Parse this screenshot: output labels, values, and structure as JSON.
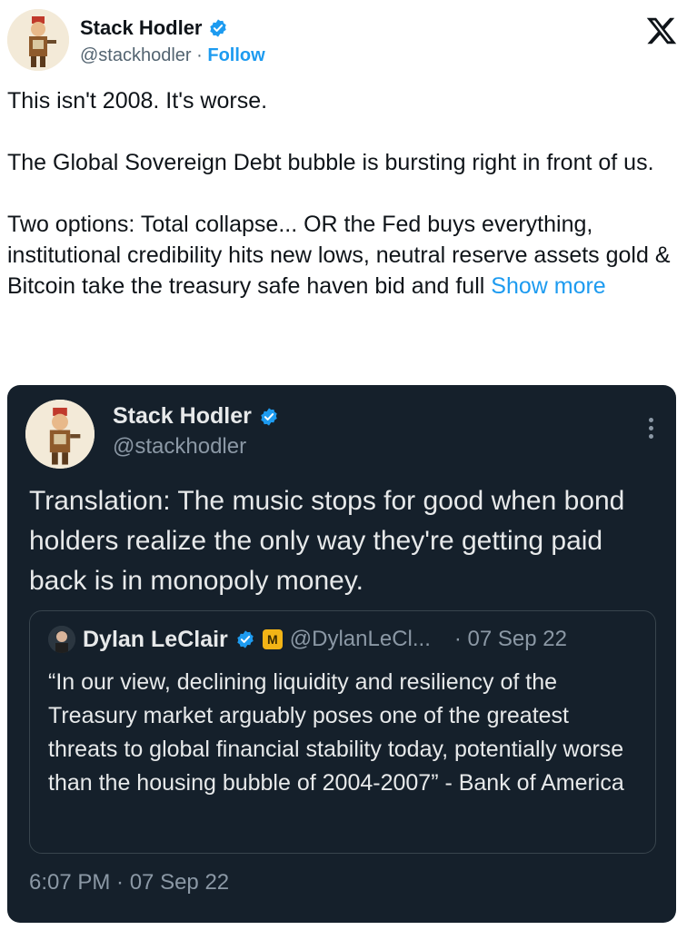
{
  "author": {
    "name": "Stack Hodler",
    "handle": "@stackhodler",
    "separator": " · ",
    "follow_label": "Follow"
  },
  "tweet": {
    "text": "This isn't 2008. It's worse.\n\nThe Global Sovereign Debt bubble is bursting right in front of us.\n\nTwo options: Total collapse... OR the Fed buys everything, institutional credibility hits new lows, neutral reserve assets gold & Bitcoin take the treasury safe haven bid and full ",
    "show_more": "Show more"
  },
  "quoted_tweet": {
    "name": "Stack Hodler",
    "handle": "@stackhodler",
    "text": "Translation: The music stops for good when bond holders realize the only way they're getting paid back is in monopoly money.",
    "timestamp": "6:07 PM · 07 Sep 22"
  },
  "nested_quote": {
    "name": "Dylan LeClair",
    "badge_letter": "M",
    "handle": "@DylanLeCl...",
    "date": "· 07 Sep 22",
    "text": "“In our view, declining liquidity and resiliency of the Treasury market arguably poses one of the greatest threats to global financial stability today, potentially worse than the housing bubble of 2004-2007” - Bank of America"
  },
  "icons": {
    "verified": "verified-badge-icon",
    "brand": "x-logo-icon",
    "more": "more-options-icon",
    "affiliate": "affiliate-badge-icon"
  },
  "colors": {
    "link_blue": "#1d9bf0",
    "dark_card": "#15202b",
    "muted_text": "#8b98a5",
    "affiliate_gold": "#f2b416"
  }
}
